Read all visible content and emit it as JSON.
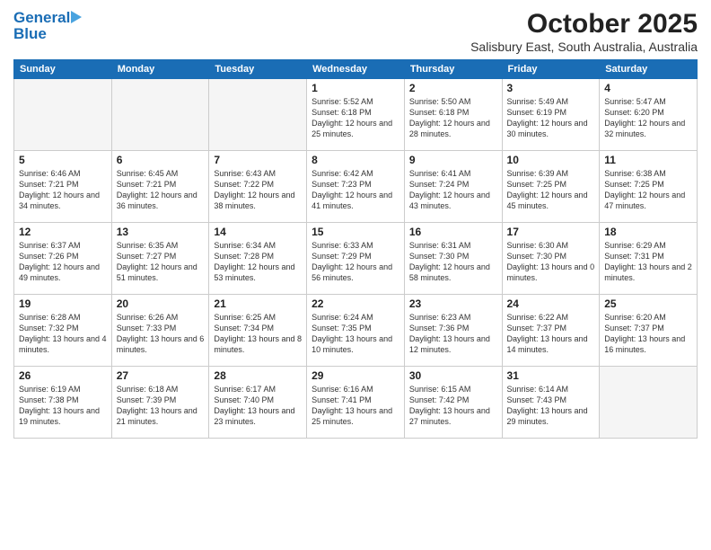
{
  "header": {
    "logo_general": "General",
    "logo_blue": "Blue",
    "month_title": "October 2025",
    "location": "Salisbury East, South Australia, Australia"
  },
  "days_of_week": [
    "Sunday",
    "Monday",
    "Tuesday",
    "Wednesday",
    "Thursday",
    "Friday",
    "Saturday"
  ],
  "weeks": [
    [
      {
        "day": "",
        "detail": ""
      },
      {
        "day": "",
        "detail": ""
      },
      {
        "day": "",
        "detail": ""
      },
      {
        "day": "1",
        "detail": "Sunrise: 5:52 AM\nSunset: 6:18 PM\nDaylight: 12 hours\nand 25 minutes."
      },
      {
        "day": "2",
        "detail": "Sunrise: 5:50 AM\nSunset: 6:18 PM\nDaylight: 12 hours\nand 28 minutes."
      },
      {
        "day": "3",
        "detail": "Sunrise: 5:49 AM\nSunset: 6:19 PM\nDaylight: 12 hours\nand 30 minutes."
      },
      {
        "day": "4",
        "detail": "Sunrise: 5:47 AM\nSunset: 6:20 PM\nDaylight: 12 hours\nand 32 minutes."
      }
    ],
    [
      {
        "day": "5",
        "detail": "Sunrise: 6:46 AM\nSunset: 7:21 PM\nDaylight: 12 hours\nand 34 minutes."
      },
      {
        "day": "6",
        "detail": "Sunrise: 6:45 AM\nSunset: 7:21 PM\nDaylight: 12 hours\nand 36 minutes."
      },
      {
        "day": "7",
        "detail": "Sunrise: 6:43 AM\nSunset: 7:22 PM\nDaylight: 12 hours\nand 38 minutes."
      },
      {
        "day": "8",
        "detail": "Sunrise: 6:42 AM\nSunset: 7:23 PM\nDaylight: 12 hours\nand 41 minutes."
      },
      {
        "day": "9",
        "detail": "Sunrise: 6:41 AM\nSunset: 7:24 PM\nDaylight: 12 hours\nand 43 minutes."
      },
      {
        "day": "10",
        "detail": "Sunrise: 6:39 AM\nSunset: 7:25 PM\nDaylight: 12 hours\nand 45 minutes."
      },
      {
        "day": "11",
        "detail": "Sunrise: 6:38 AM\nSunset: 7:25 PM\nDaylight: 12 hours\nand 47 minutes."
      }
    ],
    [
      {
        "day": "12",
        "detail": "Sunrise: 6:37 AM\nSunset: 7:26 PM\nDaylight: 12 hours\nand 49 minutes."
      },
      {
        "day": "13",
        "detail": "Sunrise: 6:35 AM\nSunset: 7:27 PM\nDaylight: 12 hours\nand 51 minutes."
      },
      {
        "day": "14",
        "detail": "Sunrise: 6:34 AM\nSunset: 7:28 PM\nDaylight: 12 hours\nand 53 minutes."
      },
      {
        "day": "15",
        "detail": "Sunrise: 6:33 AM\nSunset: 7:29 PM\nDaylight: 12 hours\nand 56 minutes."
      },
      {
        "day": "16",
        "detail": "Sunrise: 6:31 AM\nSunset: 7:30 PM\nDaylight: 12 hours\nand 58 minutes."
      },
      {
        "day": "17",
        "detail": "Sunrise: 6:30 AM\nSunset: 7:30 PM\nDaylight: 13 hours\nand 0 minutes."
      },
      {
        "day": "18",
        "detail": "Sunrise: 6:29 AM\nSunset: 7:31 PM\nDaylight: 13 hours\nand 2 minutes."
      }
    ],
    [
      {
        "day": "19",
        "detail": "Sunrise: 6:28 AM\nSunset: 7:32 PM\nDaylight: 13 hours\nand 4 minutes."
      },
      {
        "day": "20",
        "detail": "Sunrise: 6:26 AM\nSunset: 7:33 PM\nDaylight: 13 hours\nand 6 minutes."
      },
      {
        "day": "21",
        "detail": "Sunrise: 6:25 AM\nSunset: 7:34 PM\nDaylight: 13 hours\nand 8 minutes."
      },
      {
        "day": "22",
        "detail": "Sunrise: 6:24 AM\nSunset: 7:35 PM\nDaylight: 13 hours\nand 10 minutes."
      },
      {
        "day": "23",
        "detail": "Sunrise: 6:23 AM\nSunset: 7:36 PM\nDaylight: 13 hours\nand 12 minutes."
      },
      {
        "day": "24",
        "detail": "Sunrise: 6:22 AM\nSunset: 7:37 PM\nDaylight: 13 hours\nand 14 minutes."
      },
      {
        "day": "25",
        "detail": "Sunrise: 6:20 AM\nSunset: 7:37 PM\nDaylight: 13 hours\nand 16 minutes."
      }
    ],
    [
      {
        "day": "26",
        "detail": "Sunrise: 6:19 AM\nSunset: 7:38 PM\nDaylight: 13 hours\nand 19 minutes."
      },
      {
        "day": "27",
        "detail": "Sunrise: 6:18 AM\nSunset: 7:39 PM\nDaylight: 13 hours\nand 21 minutes."
      },
      {
        "day": "28",
        "detail": "Sunrise: 6:17 AM\nSunset: 7:40 PM\nDaylight: 13 hours\nand 23 minutes."
      },
      {
        "day": "29",
        "detail": "Sunrise: 6:16 AM\nSunset: 7:41 PM\nDaylight: 13 hours\nand 25 minutes."
      },
      {
        "day": "30",
        "detail": "Sunrise: 6:15 AM\nSunset: 7:42 PM\nDaylight: 13 hours\nand 27 minutes."
      },
      {
        "day": "31",
        "detail": "Sunrise: 6:14 AM\nSunset: 7:43 PM\nDaylight: 13 hours\nand 29 minutes."
      },
      {
        "day": "",
        "detail": ""
      }
    ]
  ]
}
